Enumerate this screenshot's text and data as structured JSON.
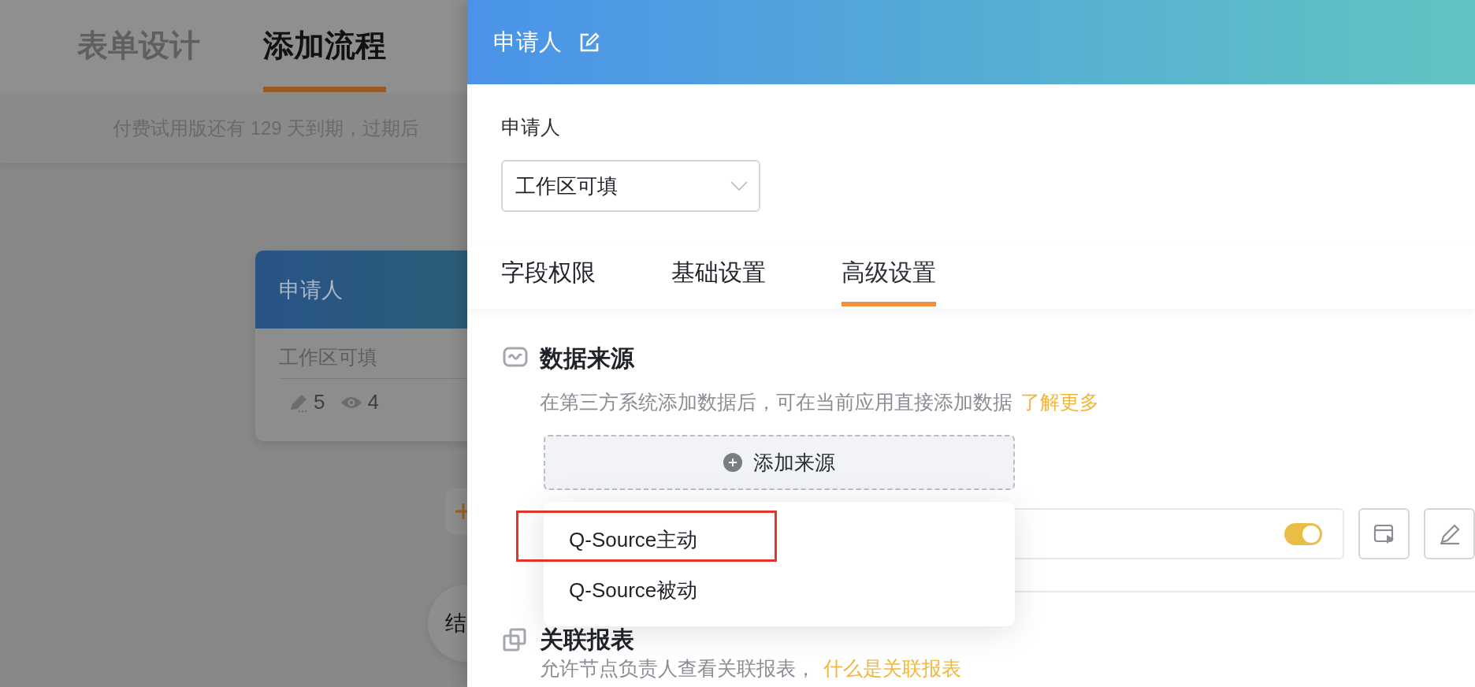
{
  "background_page": {
    "tabs": [
      {
        "label": "表单设计",
        "selected": false
      },
      {
        "label": "添加流程",
        "selected": true
      }
    ],
    "notice": "付费试用版还有 129 天到期，过期后",
    "node": {
      "title": "申请人",
      "permission": "工作区可填",
      "edit_count": "5",
      "view_count": "4"
    },
    "end_node": "结"
  },
  "drawer": {
    "title": "申请人",
    "role_label": "申请人",
    "role_select": {
      "value": "工作区可填"
    },
    "tabs": [
      {
        "label": "字段权限",
        "selected": false
      },
      {
        "label": "基础设置",
        "selected": false
      },
      {
        "label": "高级设置",
        "selected": true
      }
    ],
    "sections": [
      {
        "kind": "data_source",
        "title": "数据来源",
        "description": "在第三方系统添加数据后，可在当前应用直接添加数据",
        "link": "了解更多",
        "add_button": "添加来源",
        "source_row": {
          "on": true
        }
      },
      {
        "kind": "report",
        "title": "关联报表",
        "description": "允许节点负责人查看关联报表，",
        "link": "什么是关联报表"
      }
    ]
  },
  "dropdown": {
    "items": [
      {
        "label": "Q-Source主动",
        "highlighted": true
      },
      {
        "label": "Q-Source被动",
        "highlighted": false
      }
    ]
  }
}
